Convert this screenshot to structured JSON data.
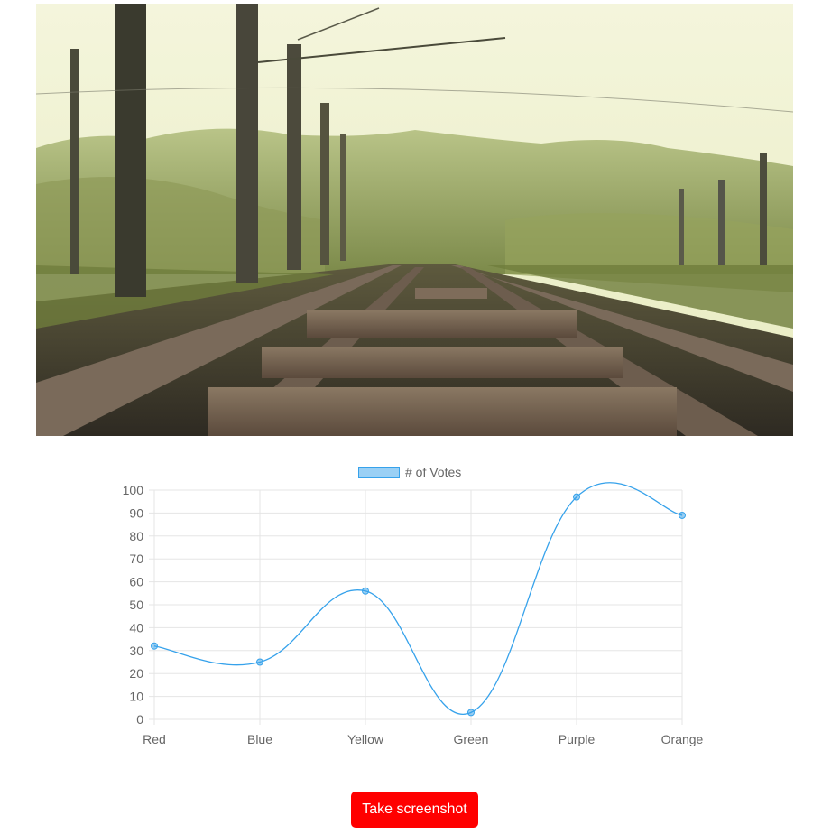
{
  "hero_image": {
    "description": "railway tracks photograph"
  },
  "chart_data": {
    "type": "line",
    "categories": [
      "Red",
      "Blue",
      "Yellow",
      "Green",
      "Purple",
      "Orange"
    ],
    "series": [
      {
        "name": "# of Votes",
        "values": [
          32,
          25,
          56,
          3,
          97,
          89
        ]
      }
    ],
    "ylim": [
      0,
      100
    ],
    "yticks": [
      0,
      10,
      20,
      30,
      40,
      50,
      60,
      70,
      80,
      90,
      100
    ],
    "grid": true,
    "legend_position": "top",
    "colors": {
      "line": "#36a2eb",
      "point_fill": "rgba(54,162,235,0.5)",
      "grid": "#e5e5e5",
      "tick_text": "#666666"
    }
  },
  "button": {
    "label": "Take screenshot",
    "color": "#ff0000"
  }
}
